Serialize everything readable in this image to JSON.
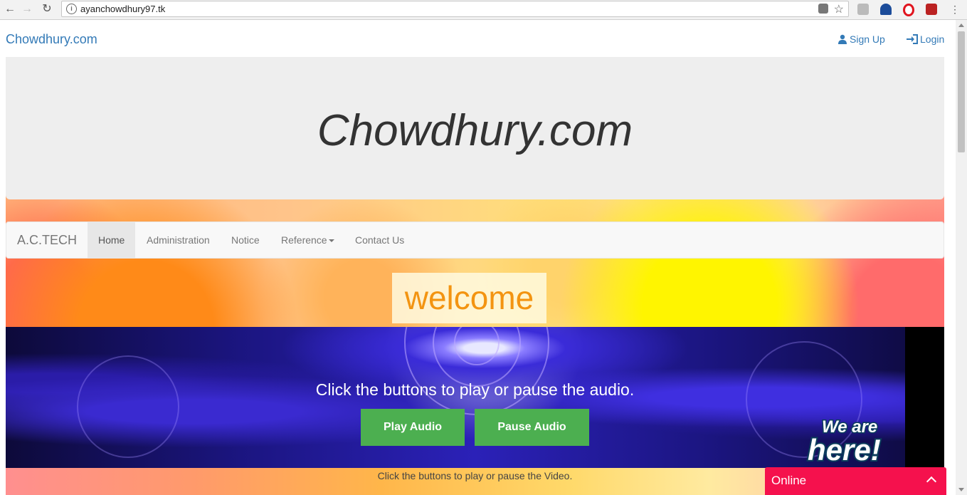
{
  "browser": {
    "url": "ayanchowdhury97.tk"
  },
  "site": {
    "brand": "Chowdhury.com",
    "sign_up": "Sign Up",
    "login": "Login"
  },
  "jumbotron": {
    "title": "Chowdhury.com"
  },
  "navbar": {
    "brand": "A.C.TECH",
    "items": [
      {
        "label": "Home",
        "active": true
      },
      {
        "label": "Administration"
      },
      {
        "label": "Notice"
      },
      {
        "label": "Reference",
        "dropdown": true
      },
      {
        "label": "Contact Us"
      }
    ]
  },
  "welcome": "welcome",
  "audio": {
    "prompt": "Click the buttons to play or pause the audio.",
    "play": "Play Audio",
    "pause": "Pause Audio"
  },
  "video": {
    "prompt": "Click the buttons to play or pause the Video."
  },
  "badge": {
    "line1": "We are",
    "line2": "here!"
  },
  "chat": {
    "status": "Online"
  },
  "colors": {
    "link": "#337ab7",
    "button_green": "#4caf50",
    "chat_red": "#f5114d",
    "welcome_orange": "#f39411"
  }
}
